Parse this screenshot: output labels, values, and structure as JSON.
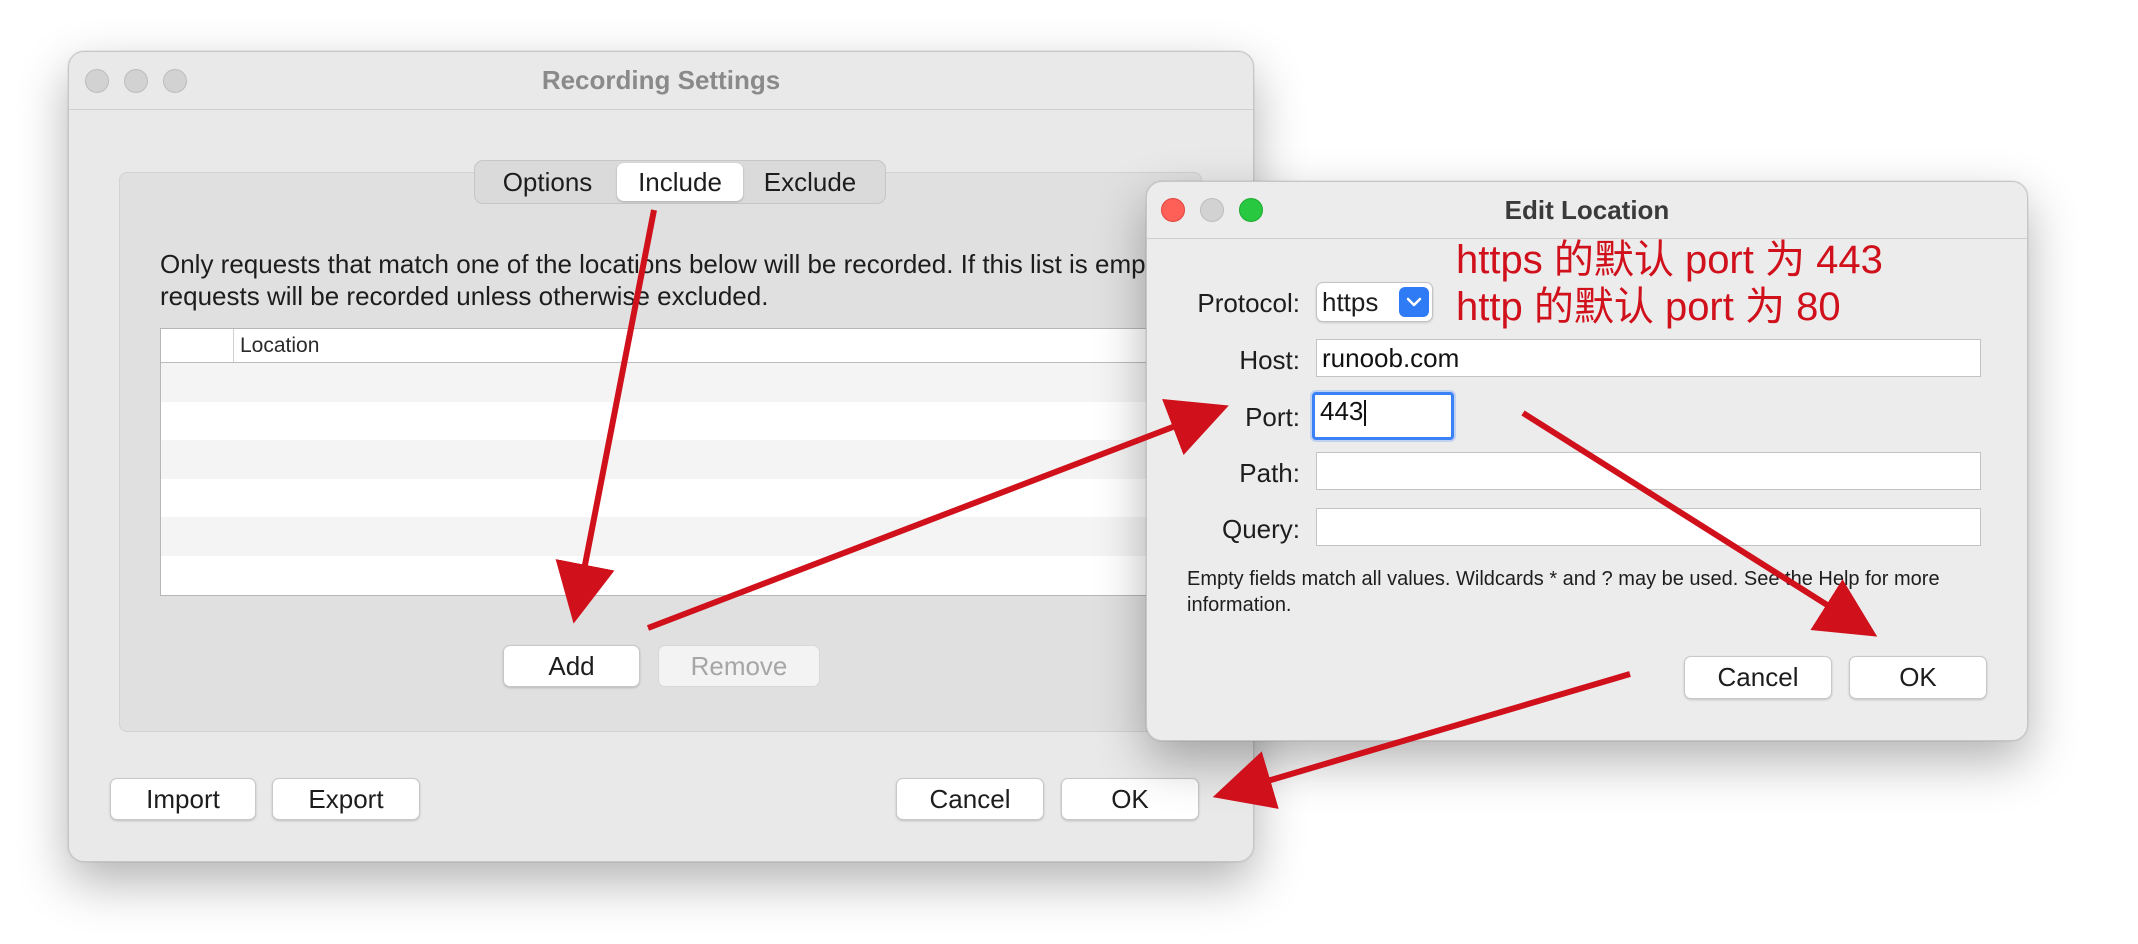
{
  "recording_settings": {
    "title": "Recording Settings",
    "tabs": [
      {
        "label": "Options",
        "selected": false
      },
      {
        "label": "Include",
        "selected": true
      },
      {
        "label": "Exclude",
        "selected": false
      }
    ],
    "description": "Only requests that match one of the locations below will be recorded. If this list is empty, all requests will be recorded unless otherwise excluded.",
    "table": {
      "columns": [
        "",
        "Location"
      ],
      "rows": []
    },
    "add_label": "Add",
    "remove_label": "Remove",
    "import_label": "Import",
    "export_label": "Export",
    "cancel_label": "Cancel",
    "ok_label": "OK"
  },
  "edit_location": {
    "title": "Edit Location",
    "protocol_label": "Protocol:",
    "protocol_value": "https",
    "host_label": "Host:",
    "host_value": "runoob.com",
    "port_label": "Port:",
    "port_value": "443",
    "path_label": "Path:",
    "path_value": "",
    "query_label": "Query:",
    "query_value": "",
    "note": "Empty fields match all values. Wildcards * and ? may be used. See the Help for more information.",
    "cancel_label": "Cancel",
    "ok_label": "OK"
  },
  "annotation": {
    "line1": "https 的默认 port 为 443",
    "line2": "http 的默认 port 为 80",
    "color": "#d0101b"
  }
}
